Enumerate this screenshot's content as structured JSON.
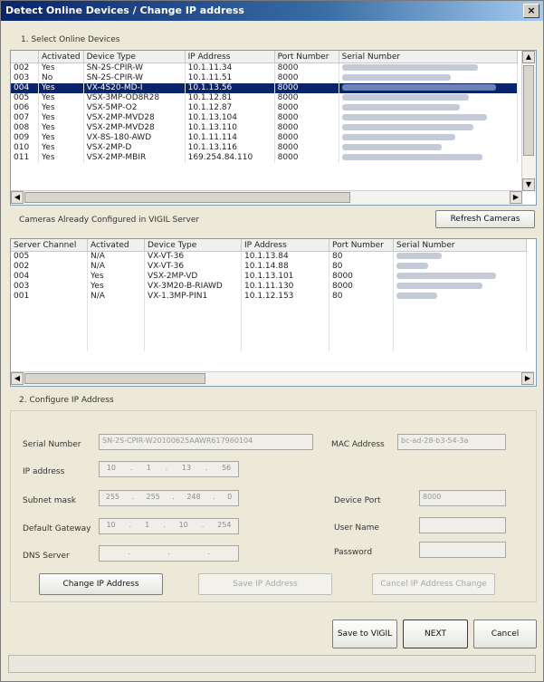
{
  "window": {
    "title": "Detect Online Devices / Change IP address",
    "close_glyph": "×"
  },
  "online": {
    "label": "1. Select Online Devices",
    "columns": [
      "",
      "Activated",
      "Device Type",
      "IP Address",
      "Port Number",
      "Serial Number"
    ],
    "rows": [
      [
        "002",
        "Yes",
        "SN-2S-CPIR-W",
        "10.1.11.34",
        "8000"
      ],
      [
        "003",
        "No",
        "SN-2S-CPIR-W",
        "10.1.11.51",
        "8000"
      ],
      [
        "004",
        "Yes",
        "VX-4S20-MD-I",
        "10.1.13.56",
        "8000"
      ],
      [
        "005",
        "Yes",
        "VSX-3MP-OD8R28",
        "10.1.12.81",
        "8000"
      ],
      [
        "006",
        "Yes",
        "VSX-5MP-O2",
        "10.1.12.87",
        "8000"
      ],
      [
        "007",
        "Yes",
        "VSX-2MP-MVD28",
        "10.1.13.104",
        "8000"
      ],
      [
        "008",
        "Yes",
        "VSX-2MP-MVD28",
        "10.1.13.110",
        "8000"
      ],
      [
        "009",
        "Yes",
        "VX-8S-180-AWD",
        "10.1.11.114",
        "8000"
      ],
      [
        "010",
        "Yes",
        "VSX-2MP-D",
        "10.1.13.116",
        "8000"
      ],
      [
        "011",
        "Yes",
        "VSX-2MP-MBIR",
        "169.254.84.110",
        "8000"
      ]
    ],
    "selected_index": 2
  },
  "configured": {
    "label": "Cameras Already Configured in VIGIL Server",
    "refresh_label": "Refresh Cameras",
    "columns": [
      "Server Channel",
      "Activated",
      "Device Type",
      "IP Address",
      "Port Number",
      "Serial Number"
    ],
    "rows": [
      [
        "005",
        "N/A",
        "VX-VT-36",
        "10.1.13.84",
        "80"
      ],
      [
        "002",
        "N/A",
        "VX-VT-36",
        "10.1.14.88",
        "80"
      ],
      [
        "004",
        "Yes",
        "VSX-2MP-VD",
        "10.1.13.101",
        "8000"
      ],
      [
        "003",
        "Yes",
        "VX-3M20-B-RIAWD",
        "10.1.11.130",
        "8000"
      ],
      [
        "001",
        "N/A",
        "VX-1.3MP-PIN1",
        "10.1.12.153",
        "80"
      ]
    ]
  },
  "config": {
    "label": "2. Configure IP Address",
    "serial_label": "Serial Number",
    "serial_value": "SN-2S-CPIR-W20100625AAWR617960104",
    "mac_label": "MAC Address",
    "mac_value": "bc-ad-28-b3-54-3a",
    "ip_label": "IP address",
    "ip_value": [
      "10",
      "1",
      "13",
      "56"
    ],
    "subnet_label": "Subnet mask",
    "subnet_value": [
      "255",
      "255",
      "248",
      "0"
    ],
    "gateway_label": "Default Gateway",
    "gateway_value": [
      "10",
      "1",
      "10",
      "254"
    ],
    "dns_label": "DNS Server",
    "port_label": "Device Port",
    "port_value": "8000",
    "user_label": "User Name",
    "password_label": "Password",
    "change_ip_label": "Change IP Address",
    "save_ip_label": "Save IP Address",
    "cancel_change_label": "Cancel IP Address Change"
  },
  "footer": {
    "save_vigil_label": "Save to VIGIL",
    "next_label": "NEXT",
    "cancel_label": "Cancel"
  },
  "colors": {
    "title_start": "#0a246a",
    "selection": "#0a246a",
    "dialog_bg": "#ece9d8"
  }
}
